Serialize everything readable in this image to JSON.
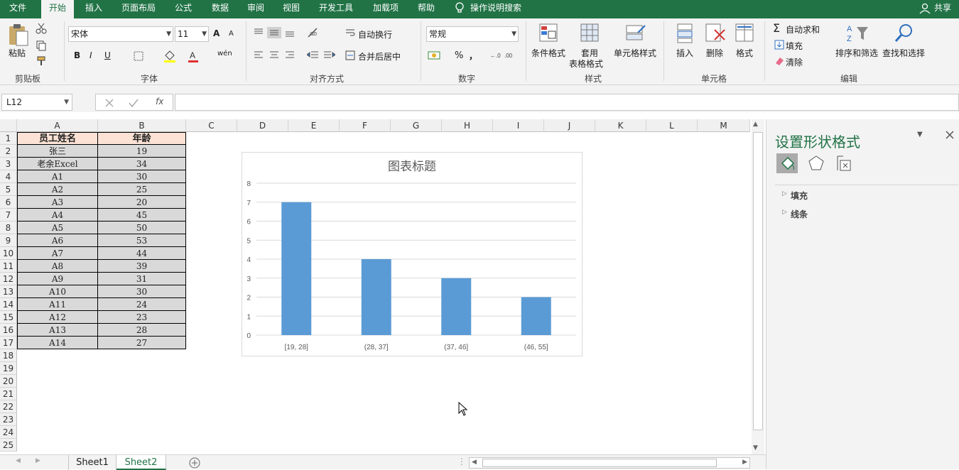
{
  "menu": {
    "tabs": [
      "文件",
      "开始",
      "插入",
      "页面布局",
      "公式",
      "数据",
      "审阅",
      "视图",
      "开发工具",
      "加载项",
      "帮助"
    ],
    "search": "操作说明搜索",
    "share": "共享"
  },
  "ribbon": {
    "clipboard": {
      "paste": "粘贴",
      "label": "剪贴板"
    },
    "font": {
      "name": "宋体",
      "size": "11",
      "bold": "B",
      "italic": "I",
      "underline": "U",
      "label": "字体",
      "grow": "A",
      "shrink": "A",
      "wen": "wén"
    },
    "alignment": {
      "wrap": "自动换行",
      "merge": "合并后居中",
      "label": "对齐方式"
    },
    "number": {
      "format": "常规",
      "percent": "%",
      "comma": "，",
      "label": "数字"
    },
    "styles": {
      "conditional": "条件格式",
      "table_line1": "套用",
      "table_line2": "表格格式",
      "cell_styles": "单元格样式",
      "label": "样式"
    },
    "cells": {
      "insert": "插入",
      "delete": "删除",
      "format": "格式",
      "label": "单元格"
    },
    "editing": {
      "autosum": "自动求和",
      "fill": "填充",
      "clear": "清除",
      "sort": "排序和筛选",
      "find": "查找和选择",
      "label": "编辑"
    }
  },
  "formula": {
    "namebox": "L12",
    "fx": "fx",
    "value": ""
  },
  "columns": [
    "A",
    "B",
    "C",
    "D",
    "E",
    "F",
    "G",
    "H",
    "I",
    "J",
    "K",
    "L",
    "M"
  ],
  "rows": [
    "1",
    "2",
    "3",
    "4",
    "5",
    "6",
    "7",
    "8",
    "9",
    "10",
    "11",
    "12",
    "13",
    "14",
    "15",
    "16",
    "17",
    "18",
    "19",
    "20",
    "21",
    "22",
    "23",
    "24",
    "25"
  ],
  "table": {
    "headers": [
      "员工姓名",
      "年龄"
    ],
    "data": [
      [
        "张三",
        "19"
      ],
      [
        "老余Excel",
        "34"
      ],
      [
        "A1",
        "30"
      ],
      [
        "A2",
        "25"
      ],
      [
        "A3",
        "20"
      ],
      [
        "A4",
        "45"
      ],
      [
        "A5",
        "50"
      ],
      [
        "A6",
        "53"
      ],
      [
        "A7",
        "44"
      ],
      [
        "A8",
        "39"
      ],
      [
        "A9",
        "31"
      ],
      [
        "A10",
        "30"
      ],
      [
        "A11",
        "24"
      ],
      [
        "A12",
        "23"
      ],
      [
        "A13",
        "28"
      ],
      [
        "A14",
        "27"
      ]
    ]
  },
  "chart_data": {
    "type": "bar",
    "title": "图表标题",
    "categories": [
      "[19, 28]",
      "(28, 37]",
      "(37, 46]",
      "(46, 55]"
    ],
    "values": [
      7,
      4,
      3,
      2
    ],
    "ylim": [
      0,
      8
    ],
    "yticks": [
      "0",
      "1",
      "2",
      "3",
      "4",
      "5",
      "6",
      "7",
      "8"
    ],
    "grid": true,
    "bar_color": "#5b9bd5"
  },
  "panel": {
    "title": "设置形状格式",
    "sections": [
      "填充",
      "线条"
    ]
  },
  "sheets": {
    "tabs": [
      "Sheet1",
      "Sheet2"
    ],
    "active": 1
  },
  "colors": {
    "brand": "#217346",
    "header_fill": "#fbe2d5",
    "cell_fill": "#d9d9d9"
  }
}
